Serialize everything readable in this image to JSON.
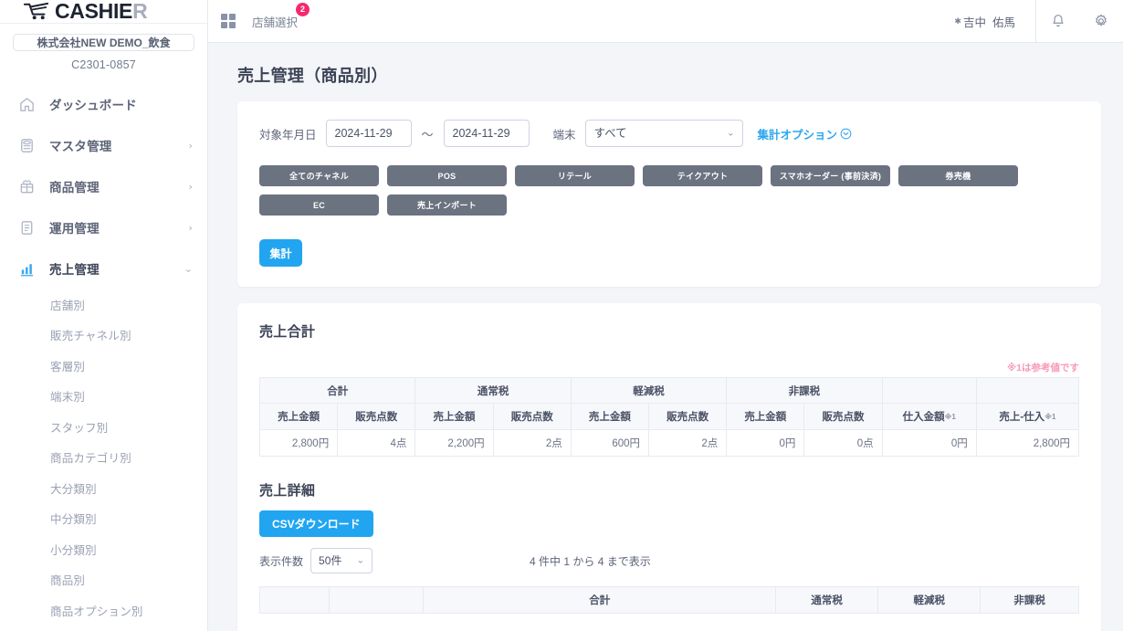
{
  "brand": {
    "name_main": "CASHIE",
    "name_accent": "R",
    "cart_icon": "shopping-cart-icon"
  },
  "sidebar": {
    "company_name": "株式会社NEW DEMO_飲食",
    "company_code": "C2301-0857",
    "nav": [
      {
        "label": "ダッシュボード",
        "icon": "home-icon",
        "chevron": "",
        "active": false
      },
      {
        "label": "マスタ管理",
        "icon": "database-icon",
        "chevron": "›",
        "active": false
      },
      {
        "label": "商品管理",
        "icon": "gift-icon",
        "chevron": "›",
        "active": false
      },
      {
        "label": "運用管理",
        "icon": "document-icon",
        "chevron": "›",
        "active": false
      },
      {
        "label": "売上管理",
        "icon": "bar-chart-icon",
        "chevron": "⌄",
        "active": true
      }
    ],
    "subnav": [
      {
        "label": "店舗別"
      },
      {
        "label": "販売チャネル別"
      },
      {
        "label": "客層別"
      },
      {
        "label": "端末別"
      },
      {
        "label": "スタッフ別"
      },
      {
        "label": "商品カテゴリ別"
      },
      {
        "label": "大分類別"
      },
      {
        "label": "中分類別"
      },
      {
        "label": "小分類別"
      },
      {
        "label": "商品別"
      },
      {
        "label": "商品オプション別"
      }
    ]
  },
  "topbar": {
    "grid_icon": "grid-icon",
    "store_select_label": "店舗選択",
    "store_badge_count": "2",
    "user_star": "✱",
    "user_last_name": "吉中",
    "user_first_name": "佑馬",
    "bell_icon": "bell-icon",
    "gear_icon": "gear-icon"
  },
  "page": {
    "title": "売上管理（商品別）"
  },
  "filter": {
    "date_label": "対象年月日",
    "date_from": "2024-11-29",
    "date_to": "2024-11-29",
    "range_separator": "～",
    "terminal_label": "端末",
    "terminal_value": "すべて",
    "terminal_options": [
      "すべて"
    ],
    "option_link": "集計オプション",
    "option_link_icon": "chevron-down-circle-icon",
    "aggregate_button": "集計",
    "channel_rows": [
      [
        "全てのチャネル",
        "POS",
        "リテール",
        "テイクアウト",
        "スマホオーダー (事前決済)",
        "券売機"
      ],
      [
        "EC",
        "売上インポート"
      ]
    ]
  },
  "sales_summary": {
    "title": "売上合計",
    "note": "※1は参考値です",
    "group_headers": [
      "合計",
      "通常税",
      "軽減税",
      "非課税"
    ],
    "sub_headers": [
      "売上金額",
      "販売点数"
    ],
    "extra_headers": [
      {
        "label": "仕入金額",
        "sup": "※1"
      },
      {
        "label": "売上-仕入",
        "sup": "※1"
      }
    ],
    "row": [
      "2,800円",
      "4点",
      "2,200円",
      "2点",
      "600円",
      "2点",
      "0円",
      "0点",
      "0円",
      "2,800円"
    ]
  },
  "sales_detail": {
    "title": "売上詳細",
    "csv_button": "CSVダウンロード",
    "count_label": "表示件数",
    "count_value": "50件",
    "count_options": [
      "50件"
    ],
    "showing_text": "4 件中 1 から 4 まで表示",
    "table_headers": [
      "",
      "",
      "合計",
      "通常税",
      "軽減税",
      "非課税"
    ]
  },
  "colors": {
    "accent_blue": "#22a5f0",
    "badge_pink": "#f5296e",
    "note_pink": "#f79ab5",
    "channel_gray": "#6b7280",
    "page_bg": "#f4f5f9"
  }
}
